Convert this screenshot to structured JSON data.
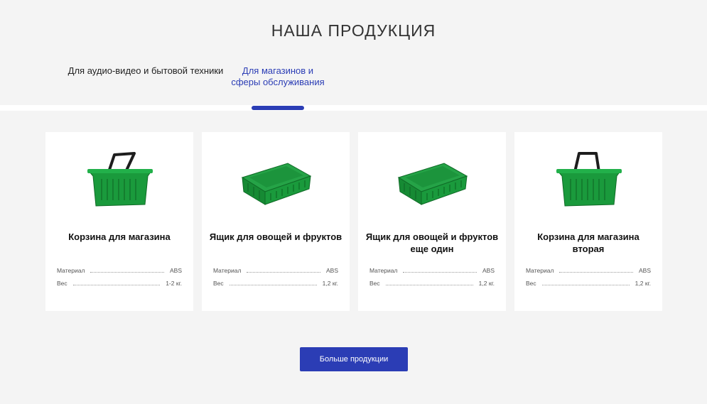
{
  "section": {
    "title": "НАША ПРОДУКЦИЯ"
  },
  "tabs": [
    {
      "label": "Для аудио-видео и бытовой техники",
      "active": false
    },
    {
      "label": "Для магазинов и сферы обслуживания",
      "active": true
    }
  ],
  "colors": {
    "accent": "#2b3db5",
    "product_green": "#1a9a3c",
    "background": "#f4f4f4"
  },
  "products": [
    {
      "name": "Корзина для магазина",
      "image": "shopping-basket",
      "specs": [
        {
          "label": "Материал",
          "value": "ABS"
        },
        {
          "label": "Вес",
          "value": "1-2 кг."
        }
      ]
    },
    {
      "name": "Ящик для овощей и фруктов",
      "image": "vegetable-crate",
      "specs": [
        {
          "label": "Материал",
          "value": "ABS"
        },
        {
          "label": "Вес",
          "value": "1,2 кг."
        }
      ]
    },
    {
      "name": "Ящик для овощей и фруктов еще один",
      "image": "vegetable-crate",
      "specs": [
        {
          "label": "Материал",
          "value": "ABS"
        },
        {
          "label": "Вес",
          "value": "1,2 кг."
        }
      ]
    },
    {
      "name": "Корзина для магазина вторая",
      "image": "shopping-basket",
      "specs": [
        {
          "label": "Материал",
          "value": "ABS"
        },
        {
          "label": "Вес",
          "value": "1,2 кг."
        }
      ]
    }
  ],
  "more_button": {
    "label": "Больше продукции"
  }
}
